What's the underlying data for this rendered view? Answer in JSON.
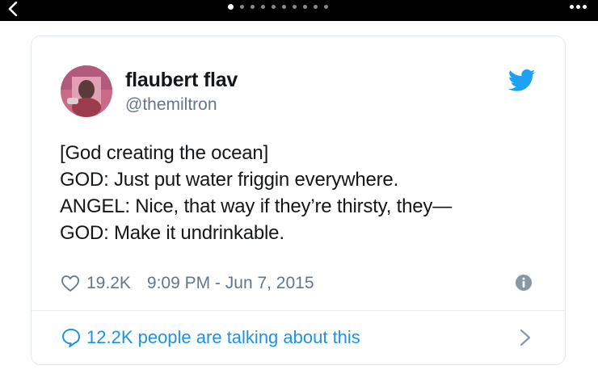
{
  "tweet": {
    "display_name": "flaubert flav",
    "handle": "@themiltron",
    "lines": [
      "[God creating the ocean]",
      "GOD: Just put water friggin everywhere.",
      "ANGEL: Nice, that way if they’re thirsty, they—",
      "GOD: Make it undrinkable."
    ],
    "like_count": "19.2K",
    "timestamp": "9:09 PM - Jun 7, 2015",
    "conversation_text": "12.2K people are talking about this"
  },
  "icons": {
    "back": "chevron-left-icon",
    "more": "more-dots-icon",
    "brand": "twitter-bird-icon",
    "like": "heart-icon",
    "info": "info-icon",
    "reply": "speech-bubble-icon",
    "forward": "chevron-right-icon"
  },
  "colors": {
    "brand_blue": "#1da1f2",
    "link_blue": "#1b95e0",
    "muted_text": "#657786",
    "top_bar": "#000000"
  },
  "pager": {
    "total": 10,
    "active_index": 0
  }
}
